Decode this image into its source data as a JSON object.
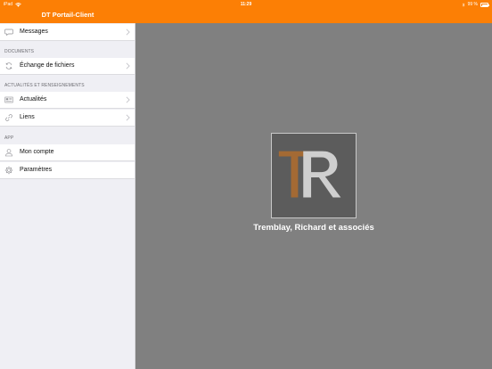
{
  "status_bar": {
    "device": "iPad",
    "time": "11:29",
    "battery": "99 %"
  },
  "header": {
    "title": "DT Portail-Client"
  },
  "sidebar": {
    "items_top": [
      {
        "label": "Messages",
        "icon": "chat-bubble-icon"
      }
    ],
    "sections": [
      {
        "title": "DOCUMENTS",
        "items": [
          {
            "label": "Échange de fichiers",
            "icon": "sync-icon"
          }
        ]
      },
      {
        "title": "ACTUALITÉS ET RENSEIGNEMENTS",
        "items": [
          {
            "label": "Actualités",
            "icon": "newspaper-icon"
          },
          {
            "label": "Liens",
            "icon": "link-icon"
          }
        ]
      },
      {
        "title": "APP",
        "items": [
          {
            "label": "Mon compte",
            "icon": "user-icon"
          },
          {
            "label": "Paramètres",
            "icon": "gear-icon"
          }
        ]
      }
    ]
  },
  "main": {
    "logo_letters": "TR",
    "company_name": "Tremblay, Richard et associés"
  },
  "colors": {
    "accent": "#fc7f05",
    "sidebar_bg": "#efeff4",
    "main_bg": "#808080",
    "logo_bg": "#5c5c5c",
    "logo_t": "#a46a34",
    "logo_r": "#cfcfcf"
  }
}
